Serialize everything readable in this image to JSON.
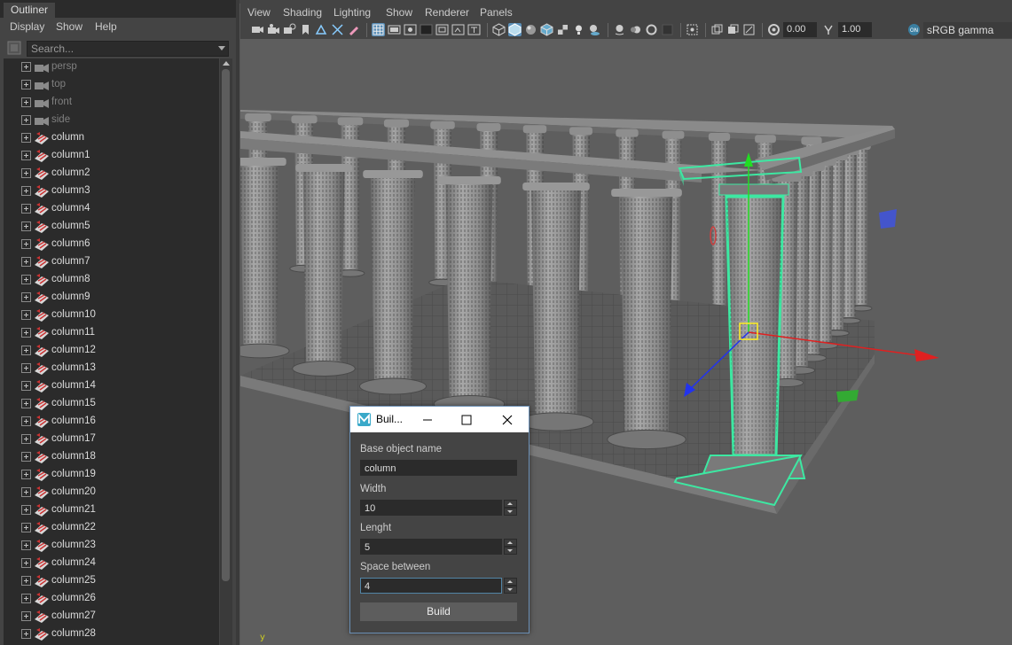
{
  "outliner": {
    "tab": "Outliner",
    "menus": [
      "Display",
      "Show",
      "Help"
    ],
    "search_placeholder": "Search...",
    "cameras": [
      "persp",
      "top",
      "front",
      "side"
    ],
    "objects": [
      "column",
      "column1",
      "column2",
      "column3",
      "column4",
      "column5",
      "column6",
      "column7",
      "column8",
      "column9",
      "column10",
      "column11",
      "column12",
      "column13",
      "column14",
      "column15",
      "column16",
      "column17",
      "column18",
      "column19",
      "column20",
      "column21",
      "column22",
      "column23",
      "column24",
      "column25",
      "column26",
      "column27",
      "column28"
    ]
  },
  "viewport": {
    "menus": [
      "View",
      "Shading",
      "Lighting",
      "Show",
      "Renderer",
      "Panels"
    ],
    "exposure": "0.00",
    "gamma": "1.00",
    "color_space": "sRGB gamma",
    "axis_label": "y",
    "colors": {
      "selection": "#3de8a2",
      "x_axis": "#e02020",
      "y_axis": "#22dd22",
      "z_axis": "#2233ee"
    }
  },
  "dialog": {
    "title": "Buil...",
    "base_label": "Base object name",
    "base_value": "column",
    "width_label": "Width",
    "width_value": "10",
    "length_label": "Lenght",
    "length_value": "5",
    "space_label": "Space between",
    "space_value": "4",
    "build_label": "Build"
  }
}
